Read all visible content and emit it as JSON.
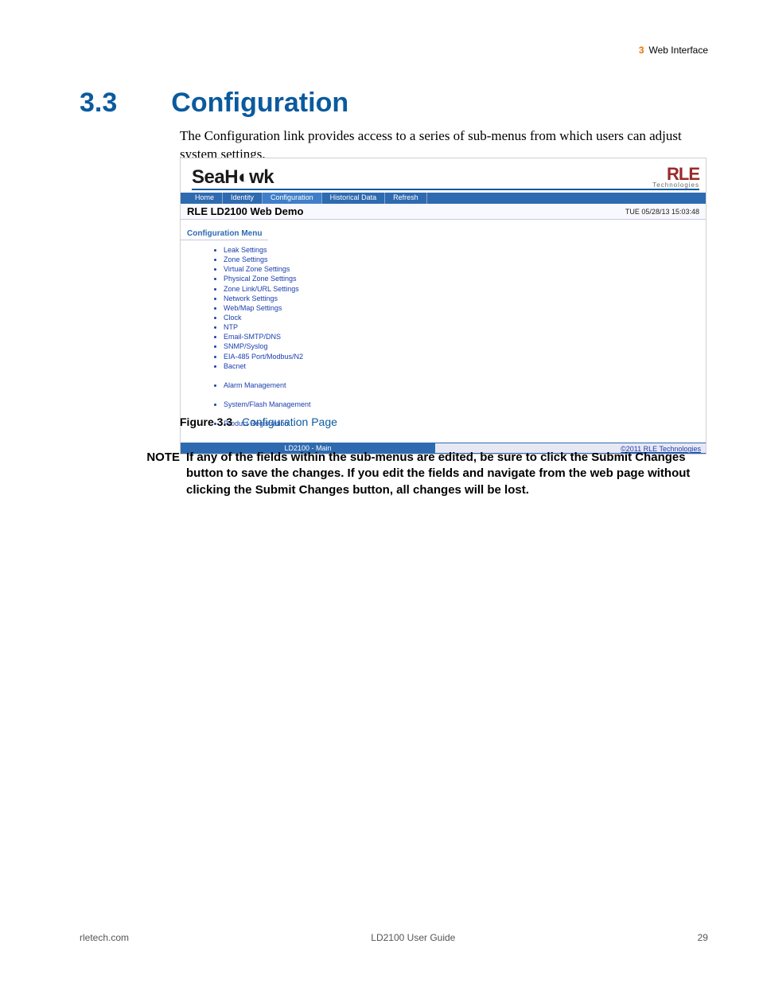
{
  "header": {
    "chapter_num": "3",
    "chapter_title": "Web Interface"
  },
  "section": {
    "number": "3.3",
    "title": "Configuration"
  },
  "intro": "The Configuration link provides access to a series of sub-menus from which users can adjust system settings.",
  "screenshot": {
    "brand_left": "SeaHawk",
    "brand_right_top": "RLE",
    "brand_right_bot": "Technologies",
    "tabs": [
      "Home",
      "Identity",
      "Configuration",
      "Historical Data",
      "Refresh"
    ],
    "active_tab_index": 2,
    "page_title": "RLE LD2100 Web Demo",
    "timestamp": "TUE 05/28/13 15:03:48",
    "subtitle": "Configuration Menu",
    "menu1": [
      "Leak Settings",
      "Zone Settings",
      "Virtual Zone Settings",
      "Physical Zone Settings",
      "Zone Link/URL Settings",
      "Network Settings",
      "Web/Map Settings",
      "Clock",
      "NTP",
      "Email-SMTP/DNS",
      "SNMP/Syslog",
      "EIA-485 Port/Modbus/N2",
      "Bacnet"
    ],
    "menu2": [
      "Alarm Management"
    ],
    "menu3": [
      "System/Flash Management"
    ],
    "menu4": [
      "Product Registration"
    ],
    "footer_left": "LD2100 - Main",
    "footer_right": "©2011 RLE Technologies"
  },
  "figure": {
    "label": "Figure 3.3",
    "title": "Configuration Page"
  },
  "note": {
    "label": "NOTE",
    "text": "If any of the fields within the sub-menus are edited, be sure to click the Submit Changes button to save the changes. If you edit the fields and navigate from the web page without clicking the Submit Changes button, all changes will be lost."
  },
  "footer": {
    "left": "rletech.com",
    "center": "LD2100 User Guide",
    "right": "29"
  }
}
